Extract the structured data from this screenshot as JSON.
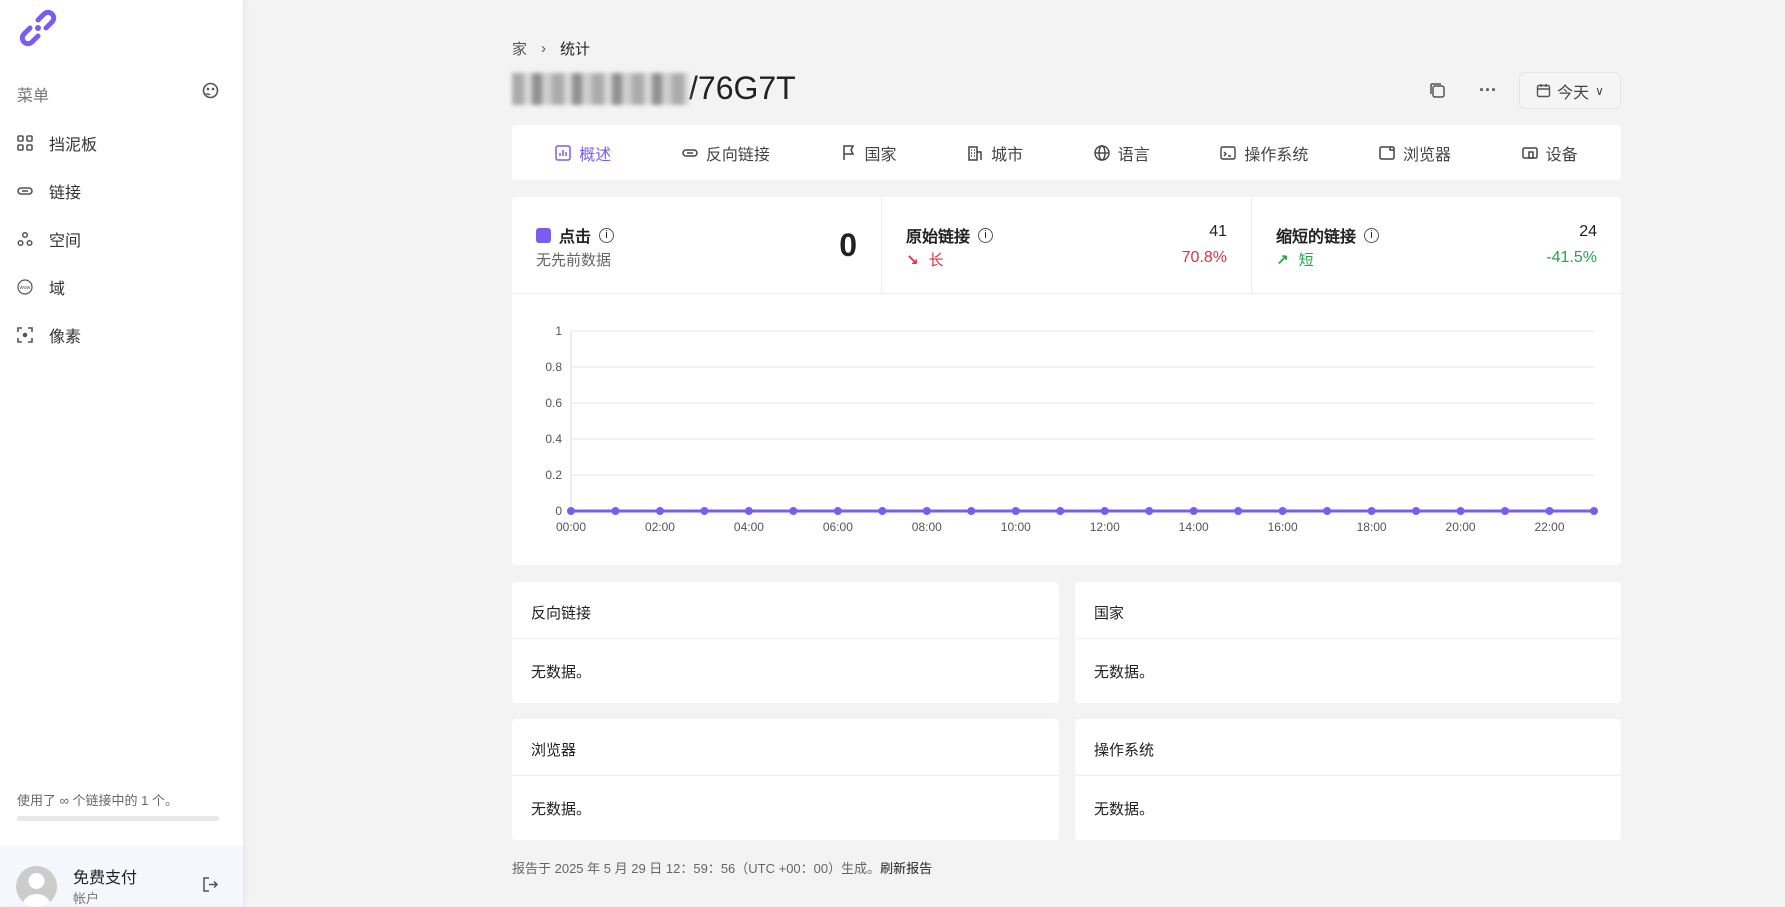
{
  "sidebar": {
    "menu_label": "菜单",
    "items": [
      {
        "label": "挡泥板",
        "icon": "grid-icon"
      },
      {
        "label": "链接",
        "icon": "link-icon"
      },
      {
        "label": "空间",
        "icon": "spaces-icon"
      },
      {
        "label": "域",
        "icon": "www-icon"
      },
      {
        "label": "像素",
        "icon": "pixel-icon"
      }
    ],
    "usage": "使用了 ∞ 个链接中的 1 个。",
    "usage_fraction": 0,
    "account": {
      "name": "免费支付",
      "sub": "帐户"
    }
  },
  "breadcrumb": {
    "home": "家",
    "current": "统计"
  },
  "title": {
    "suffix": "/76G7T"
  },
  "date_button": "今天",
  "tabs": [
    "概述",
    "反向链接",
    "国家",
    "城市",
    "语言",
    "操作系统",
    "浏览器",
    "设备"
  ],
  "stats": {
    "clicks": {
      "label": "点击",
      "sub": "无先前数据",
      "value": "0"
    },
    "original": {
      "label": "原始链接",
      "value": "41",
      "trend": "长",
      "pct": "70.8%"
    },
    "short": {
      "label": "缩短的链接",
      "value": "24",
      "trend": "短",
      "pct": "-41.5%"
    }
  },
  "colors": {
    "accent": "#7b5cf0",
    "down": "#e0313f",
    "up": "#1fa74a"
  },
  "chart_data": {
    "type": "line",
    "x": [
      "00:00",
      "01:00",
      "02:00",
      "03:00",
      "04:00",
      "05:00",
      "06:00",
      "07:00",
      "08:00",
      "09:00",
      "10:00",
      "11:00",
      "12:00",
      "13:00",
      "14:00",
      "15:00",
      "16:00",
      "17:00",
      "18:00",
      "19:00",
      "20:00",
      "21:00",
      "22:00",
      "23:00"
    ],
    "xticks": [
      "00:00",
      "02:00",
      "04:00",
      "06:00",
      "08:00",
      "10:00",
      "12:00",
      "14:00",
      "16:00",
      "18:00",
      "20:00",
      "22:00"
    ],
    "series": [
      {
        "name": "点击",
        "values": [
          0,
          0,
          0,
          0,
          0,
          0,
          0,
          0,
          0,
          0,
          0,
          0,
          0,
          0,
          0,
          0,
          0,
          0,
          0,
          0,
          0,
          0,
          0,
          0
        ]
      }
    ],
    "ylim": [
      0,
      1
    ],
    "yticks": [
      "0",
      "0.2",
      "0.4",
      "0.6",
      "0.8",
      "1"
    ],
    "grid": true
  },
  "panels": [
    {
      "title": "反向链接",
      "body": "无数据。"
    },
    {
      "title": "国家",
      "body": "无数据。"
    },
    {
      "title": "浏览器",
      "body": "无数据。"
    },
    {
      "title": "操作系统",
      "body": "无数据。"
    }
  ],
  "footer": {
    "text": "报告于 2025 年 5 月 29 日 12：59：56（UTC +00：00）生成。",
    "link": "刷新报告"
  }
}
